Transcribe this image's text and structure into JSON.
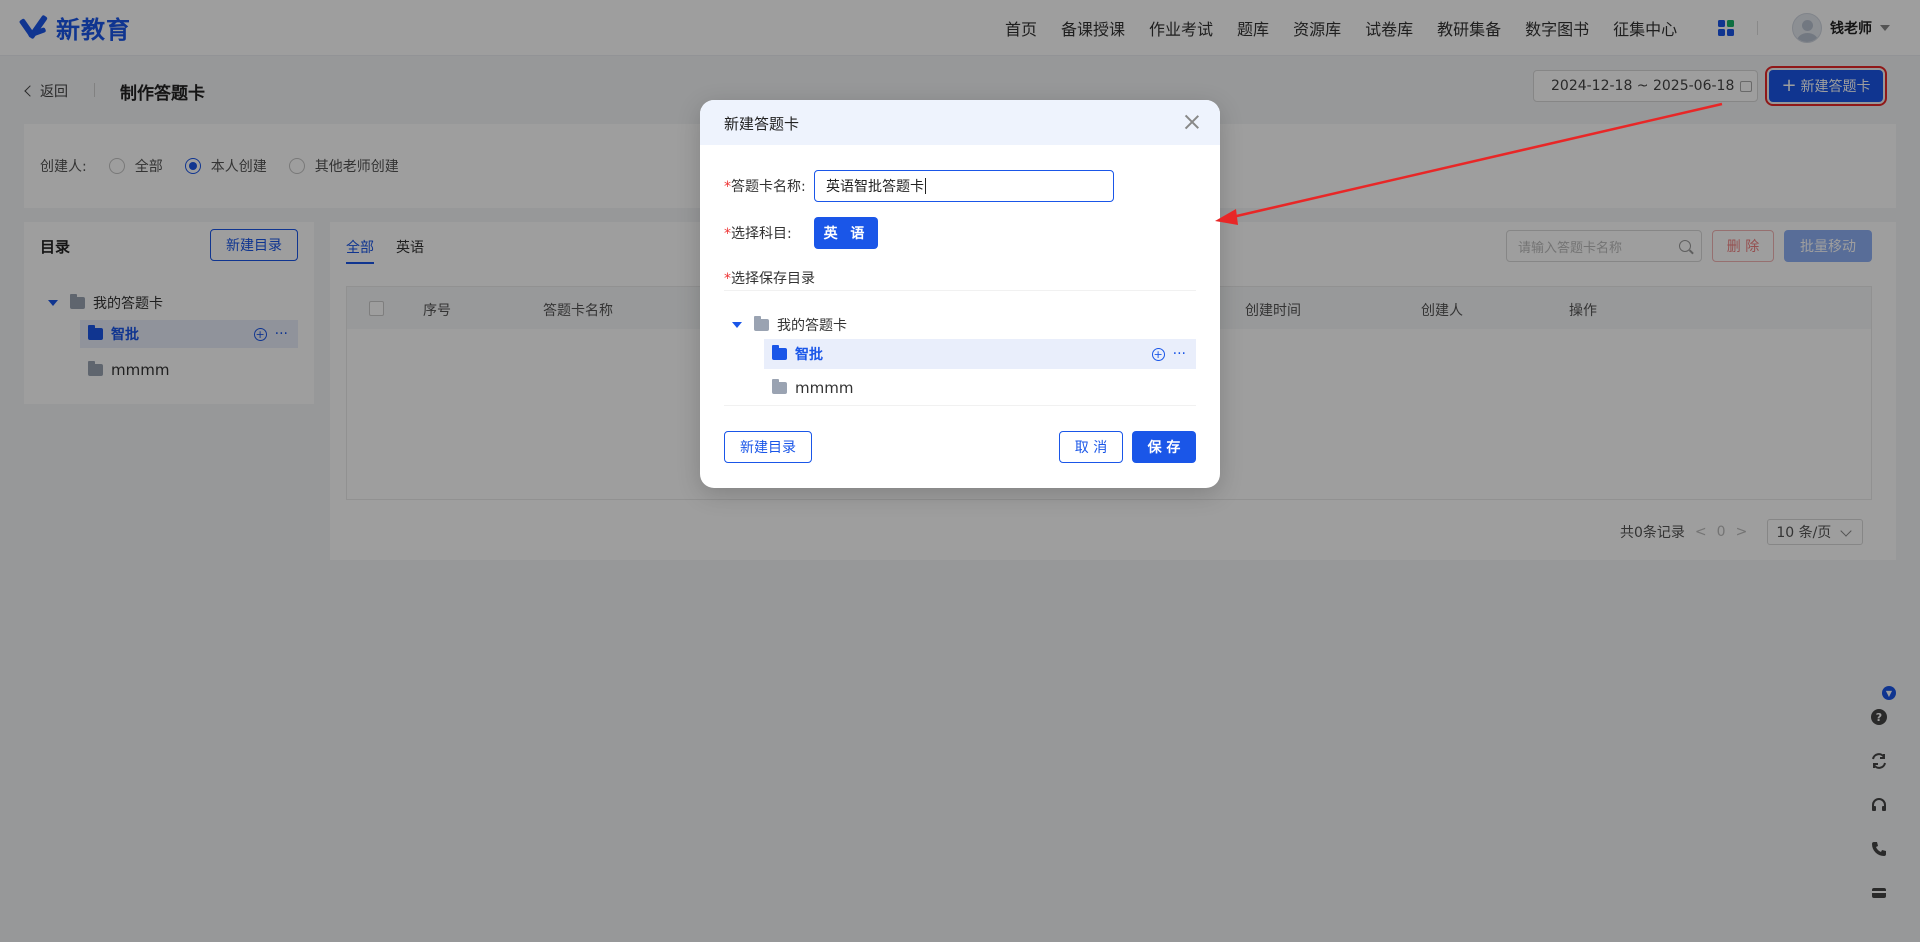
{
  "brand": {
    "logo_text": "新教育",
    "accent": "#1a56e8"
  },
  "nav": {
    "items": [
      "首页",
      "备课授课",
      "作业考试",
      "题库",
      "资源库",
      "试卷库",
      "教研集备",
      "数字图书",
      "征集中心"
    ],
    "user_name": "钱老师"
  },
  "subbar": {
    "back_label": "返回",
    "title": "制作答题卡",
    "date_range": "2024-12-18 ~ 2025-06-18",
    "new_card_label": "新建答题卡"
  },
  "filter": {
    "label": "创建人:",
    "options": [
      "全部",
      "本人创建",
      "其他老师创建"
    ],
    "selected": "本人创建"
  },
  "directory": {
    "title": "目录",
    "new_dir_label": "新建目录",
    "root": "我的答题卡",
    "children": [
      "智批",
      "mmmm"
    ],
    "selected": "智批"
  },
  "list": {
    "tabs": [
      "全部",
      "英语"
    ],
    "active_tab": "全部",
    "search_placeholder": "请输入答题卡名称",
    "delete_label": "删 除",
    "batch_move_label": "批量移动",
    "columns": [
      "序号",
      "答题卡名称",
      "创建时间",
      "创建人",
      "操作"
    ],
    "rows": [],
    "pagination": {
      "total_text": "共0条记录",
      "current_page": "0",
      "page_size": "10 条/页"
    }
  },
  "modal": {
    "title": "新建答题卡",
    "name_label": "答题卡名称:",
    "name_value": "英语智批答题卡",
    "subject_label": "选择科目:",
    "subject_value": "英 语",
    "dir_label": "选择保存目录",
    "tree_root": "我的答题卡",
    "tree_children": [
      "智批",
      "mmmm"
    ],
    "tree_selected": "智批",
    "new_dir_label": "新建目录",
    "cancel_label": "取 消",
    "save_label": "保 存"
  },
  "annotation": {
    "color": "#e82727"
  }
}
